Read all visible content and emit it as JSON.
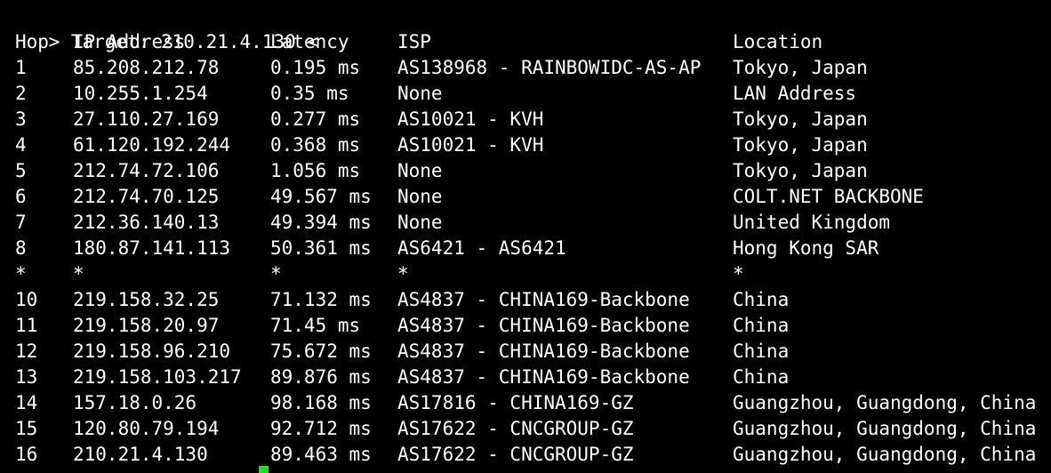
{
  "terminal": {
    "target_line": "> Target: 210.21.4.130 <",
    "headers": {
      "hop": "Hop",
      "ip": "IP Address",
      "latency": "Latency",
      "isp": "ISP",
      "location": "Location"
    },
    "rows": [
      {
        "hop": "1",
        "ip": "85.208.212.78",
        "latency": "0.195 ms",
        "isp": "AS138968 - RAINBOWIDC-AS-AP",
        "location": "Tokyo, Japan"
      },
      {
        "hop": "2",
        "ip": "10.255.1.254",
        "latency": "0.35 ms",
        "isp": "None",
        "location": "LAN Address"
      },
      {
        "hop": "3",
        "ip": "27.110.27.169",
        "latency": "0.277 ms",
        "isp": "AS10021 - KVH",
        "location": "Tokyo, Japan"
      },
      {
        "hop": "4",
        "ip": "61.120.192.244",
        "latency": "0.368 ms",
        "isp": "AS10021 - KVH",
        "location": "Tokyo, Japan"
      },
      {
        "hop": "5",
        "ip": "212.74.72.106",
        "latency": "1.056 ms",
        "isp": "None",
        "location": "Tokyo, Japan"
      },
      {
        "hop": "6",
        "ip": "212.74.70.125",
        "latency": "49.567 ms",
        "isp": "None",
        "location": "COLT.NET BACKBONE"
      },
      {
        "hop": "7",
        "ip": "212.36.140.13",
        "latency": "49.394 ms",
        "isp": "None",
        "location": "United Kingdom"
      },
      {
        "hop": "8",
        "ip": "180.87.141.113",
        "latency": "50.361 ms",
        "isp": "AS6421 - AS6421",
        "location": "Hong Kong SAR"
      },
      {
        "hop": "*",
        "ip": "*",
        "latency": "*",
        "isp": "*",
        "location": "*"
      },
      {
        "hop": "10",
        "ip": "219.158.32.25",
        "latency": "71.132 ms",
        "isp": "AS4837 - CHINA169-Backbone",
        "location": "China"
      },
      {
        "hop": "11",
        "ip": "219.158.20.97",
        "latency": "71.45 ms",
        "isp": "AS4837 - CHINA169-Backbone",
        "location": "China"
      },
      {
        "hop": "12",
        "ip": "219.158.96.210",
        "latency": "75.672 ms",
        "isp": "AS4837 - CHINA169-Backbone",
        "location": "China"
      },
      {
        "hop": "13",
        "ip": "219.158.103.217",
        "latency": "89.876 ms",
        "isp": "AS4837 - CHINA169-Backbone",
        "location": "China"
      },
      {
        "hop": "14",
        "ip": "157.18.0.26",
        "latency": "98.168 ms",
        "isp": "AS17816 - CHINA169-GZ",
        "location": "Guangzhou, Guangdong, China"
      },
      {
        "hop": "15",
        "ip": "120.80.79.194",
        "latency": "92.712 ms",
        "isp": "AS17622 - CNCGROUP-GZ",
        "location": "Guangzhou, Guangdong, China"
      },
      {
        "hop": "16",
        "ip": "210.21.4.130",
        "latency": "89.463 ms",
        "isp": "AS17622 - CNCGROUP-GZ",
        "location": "Guangzhou, Guangdong, China"
      }
    ]
  },
  "colors": {
    "background": "#000000",
    "text": "#ffffff",
    "cursor": "#22dd22"
  }
}
